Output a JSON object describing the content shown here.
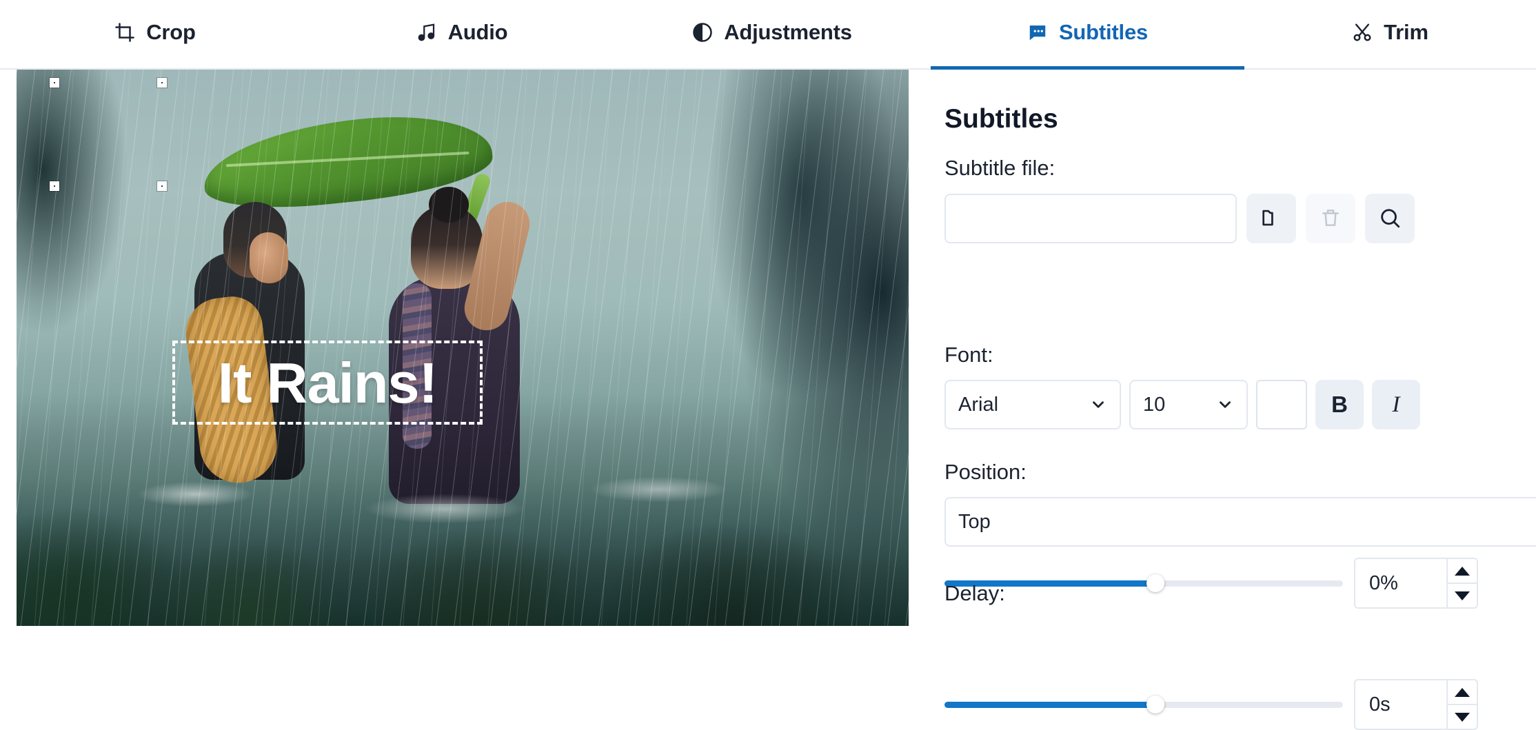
{
  "tabs": [
    {
      "label": "Crop",
      "icon": "crop-icon",
      "active": false
    },
    {
      "label": "Audio",
      "icon": "music-note-icon",
      "active": false
    },
    {
      "label": "Adjustments",
      "icon": "contrast-icon",
      "active": false
    },
    {
      "label": "Subtitles",
      "icon": "speech-bubble-icon",
      "active": true
    },
    {
      "label": "Trim",
      "icon": "scissors-icon",
      "active": false
    }
  ],
  "preview": {
    "subtitle_overlay_text": "It Rains!",
    "subtitle_color": "#ffffff",
    "selection_handles": 4
  },
  "panel": {
    "title": "Subtitles",
    "subtitle_file": {
      "label": "Subtitle file:",
      "value": "",
      "placeholder": "",
      "buttons": [
        {
          "name": "open-file-button",
          "icon": "folder-icon",
          "disabled": false
        },
        {
          "name": "delete-file-button",
          "icon": "trash-icon",
          "disabled": true
        },
        {
          "name": "search-file-button",
          "icon": "search-icon",
          "disabled": false
        }
      ]
    },
    "font": {
      "label": "Font:",
      "family": "Arial",
      "size": "10",
      "color": "#ffffff",
      "bold_label": "B",
      "italic_label": "I"
    },
    "position": {
      "label": "Position:",
      "value": "Top",
      "slider_percent": 53,
      "spinner_value": "0%"
    },
    "delay": {
      "label": "Delay:",
      "slider_percent": 53,
      "spinner_value": "0s"
    }
  },
  "colors": {
    "accent": "#1267b3",
    "slider_fill": "#1277c8",
    "panel_bg": "#ffffff",
    "icon_btn_bg": "#eef2f7",
    "border": "#e3e8ef"
  }
}
